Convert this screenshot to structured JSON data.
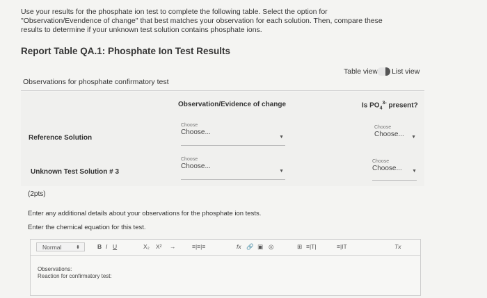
{
  "instructions": {
    "line1": "Use your results for the phosphate ion test to complete the following table. Select the option for",
    "line2": "\"Observation/Evendence of change\" that best matches your observation for each solution. Then, compare these",
    "line3": "results to determine if your unknown test solution contains phosphate ions."
  },
  "report_title": "Report Table QA.1: Phosphate Ion Test Results",
  "view_toggle": {
    "table_view": "Table view",
    "list_view": "List view"
  },
  "table": {
    "caption": "Observations for phosphate confirmatory test",
    "columns": {
      "observation": "Observation/Evidence of change",
      "po4_prefix": "Is PO",
      "po4_sub": "4",
      "po4_sup": "3-",
      "po4_suffix": " present?"
    },
    "rows": [
      {
        "label": "Reference Solution",
        "obs_small": "Choose",
        "obs_value": "Choose...",
        "po4_small": "Choose",
        "po4_value": "Choose..."
      },
      {
        "label": "Unknown Test Solution # 3",
        "obs_small": "Choose",
        "obs_value": "Choose...",
        "po4_small": "Choose",
        "po4_value": "Choose..."
      }
    ]
  },
  "points": "(2pts)",
  "prompt_details": "Enter any additional details about your observations for the phosphate ion tests.",
  "prompt_equation": "Enter the chemical equation for this test.",
  "editor": {
    "format_value": "Normal",
    "toolbar": {
      "bold": "B",
      "italic": "I",
      "underline": "U",
      "subscript": "X₂",
      "superscript": "X²",
      "arrow": "→",
      "align": "≡|≡|≡",
      "formula": "fx",
      "link": "🔗",
      "image": "▣",
      "embed": "◎",
      "table": "⊞",
      "list": "≡|T|",
      "more": "≡|IT",
      "clear": "Tx"
    },
    "content_line1": "Observations:",
    "content_line2": "Reaction for confirmatory test:"
  }
}
